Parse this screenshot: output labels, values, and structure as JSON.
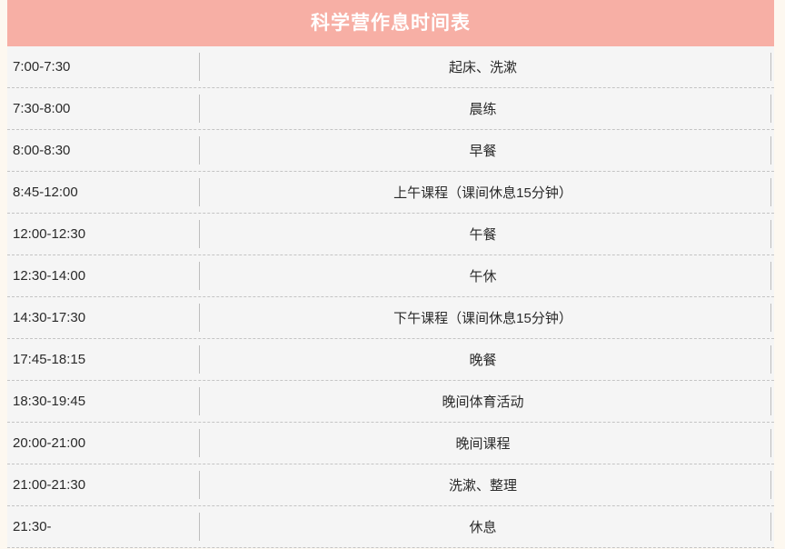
{
  "header": {
    "title": "科学营作息时间表",
    "background_color": "#f7afa5",
    "text_color": "#ffffff"
  },
  "table": {
    "row_background_color": "#f5f5f5",
    "divider_color": "#c4c4c4",
    "page_background_color": "#fdf8f0",
    "rows": [
      {
        "time": "7:00-7:30",
        "activity": "起床、洗漱"
      },
      {
        "time": "7:30-8:00",
        "activity": "晨练"
      },
      {
        "time": "8:00-8:30",
        "activity": "早餐"
      },
      {
        "time": "8:45-12:00",
        "activity": "上午课程（课间休息15分钟）"
      },
      {
        "time": "12:00-12:30",
        "activity": "午餐"
      },
      {
        "time": "12:30-14:00",
        "activity": "午休"
      },
      {
        "time": "14:30-17:30",
        "activity": "下午课程（课间休息15分钟）"
      },
      {
        "time": "17:45-18:15",
        "activity": "晚餐"
      },
      {
        "time": "18:30-19:45",
        "activity": "晚间体育活动"
      },
      {
        "time": "20:00-21:00",
        "activity": "晚间课程"
      },
      {
        "time": "21:00-21:30",
        "activity": "洗漱、整理"
      },
      {
        "time": "21:30-",
        "activity": "休息"
      }
    ]
  }
}
